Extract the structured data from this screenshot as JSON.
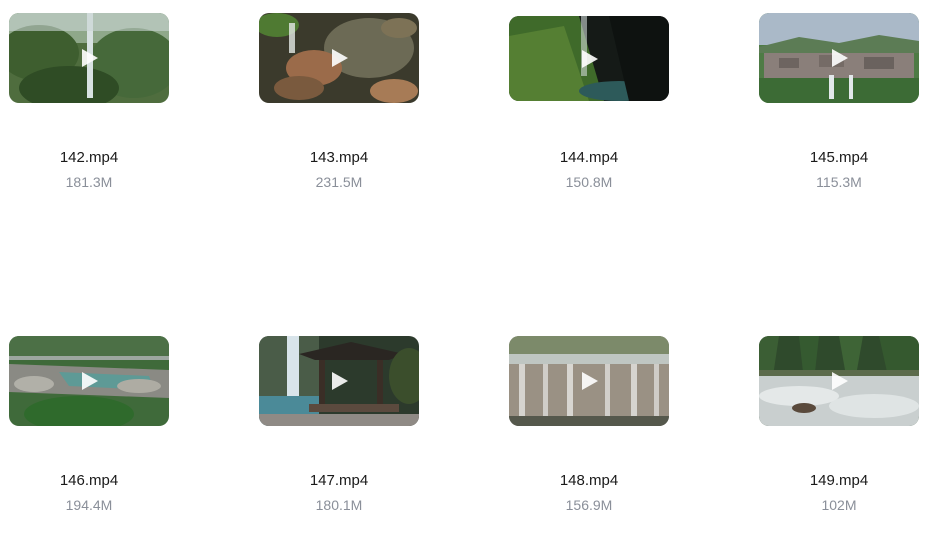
{
  "files": [
    {
      "name": "142.mp4",
      "size": "181.3M",
      "thumb": "waterfall-forest-thumbnail"
    },
    {
      "name": "143.mp4",
      "size": "231.5M",
      "thumb": "rocky-stream-thumbnail"
    },
    {
      "name": "144.mp4",
      "size": "150.8M",
      "thumb": "mossy-cliff-thumbnail"
    },
    {
      "name": "145.mp4",
      "size": "115.3M",
      "thumb": "village-waterfall-thumbnail"
    },
    {
      "name": "146.mp4",
      "size": "194.4M",
      "thumb": "river-aerial-thumbnail"
    },
    {
      "name": "147.mp4",
      "size": "180.1M",
      "thumb": "pavilion-waterfall-thumbnail"
    },
    {
      "name": "148.mp4",
      "size": "156.9M",
      "thumb": "cascade-thumbnail"
    },
    {
      "name": "149.mp4",
      "size": "102M",
      "thumb": "rapids-thumbnail"
    }
  ],
  "icons": {
    "play": "play-icon"
  }
}
